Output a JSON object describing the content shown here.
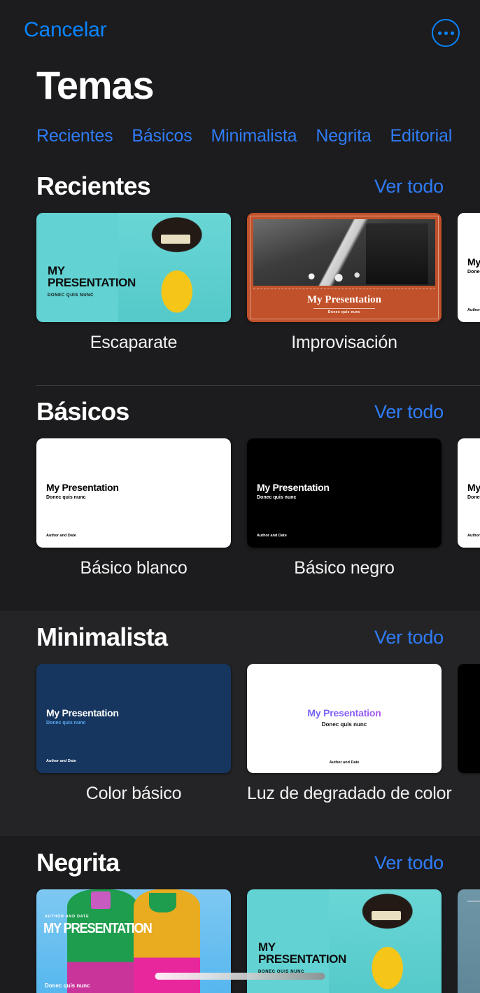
{
  "navbar": {
    "cancel_label": "Cancelar",
    "more_icon": "ellipsis-circle-icon"
  },
  "page_title": "Temas",
  "tabs": [
    {
      "label": "Recientes"
    },
    {
      "label": "Básicos"
    },
    {
      "label": "Minimalista"
    },
    {
      "label": "Negrita"
    },
    {
      "label": "Editorial"
    }
  ],
  "see_all_label": "Ver todo",
  "slide_text": {
    "title_caps_line1": "MY",
    "title_caps_line2": "PRESENTATION",
    "title_caps_single": "MY PRESENTATION",
    "title_mixed": "My Presentation",
    "subtitle_caps": "DONEC QUIS NUNC",
    "subtitle_mixed": "Donec quis nunc",
    "author": "Author and Date",
    "author_caps": "AUTHOR AND DATE"
  },
  "sections": [
    {
      "id": "recientes",
      "title": "Recientes",
      "see_all": "Ver todo",
      "items": [
        {
          "name": "Escaparate"
        },
        {
          "name": "Improvisación"
        },
        {
          "name": ""
        }
      ]
    },
    {
      "id": "basicos",
      "title": "Básicos",
      "see_all": "Ver todo",
      "items": [
        {
          "name": "Básico blanco"
        },
        {
          "name": "Básico negro"
        },
        {
          "name": ""
        }
      ]
    },
    {
      "id": "minimalista",
      "title": "Minimalista",
      "see_all": "Ver todo",
      "items": [
        {
          "name": "Color básico"
        },
        {
          "name": "Luz de degradado de color"
        },
        {
          "name": ""
        }
      ]
    },
    {
      "id": "negrita",
      "title": "Negrita",
      "see_all": "Ver todo",
      "items": [
        {
          "name": ""
        },
        {
          "name": ""
        },
        {
          "name": ""
        }
      ]
    }
  ],
  "colors": {
    "accent": "#0a84ff",
    "tab_blue": "#2f7cf6",
    "background": "#1c1c1e",
    "background_alt": "#242426",
    "title_text": "#ffffff",
    "escaparate_teal": "#62d2d2",
    "improvisacion_orange": "#c1512a",
    "color_basico_navy": "#16365f"
  }
}
